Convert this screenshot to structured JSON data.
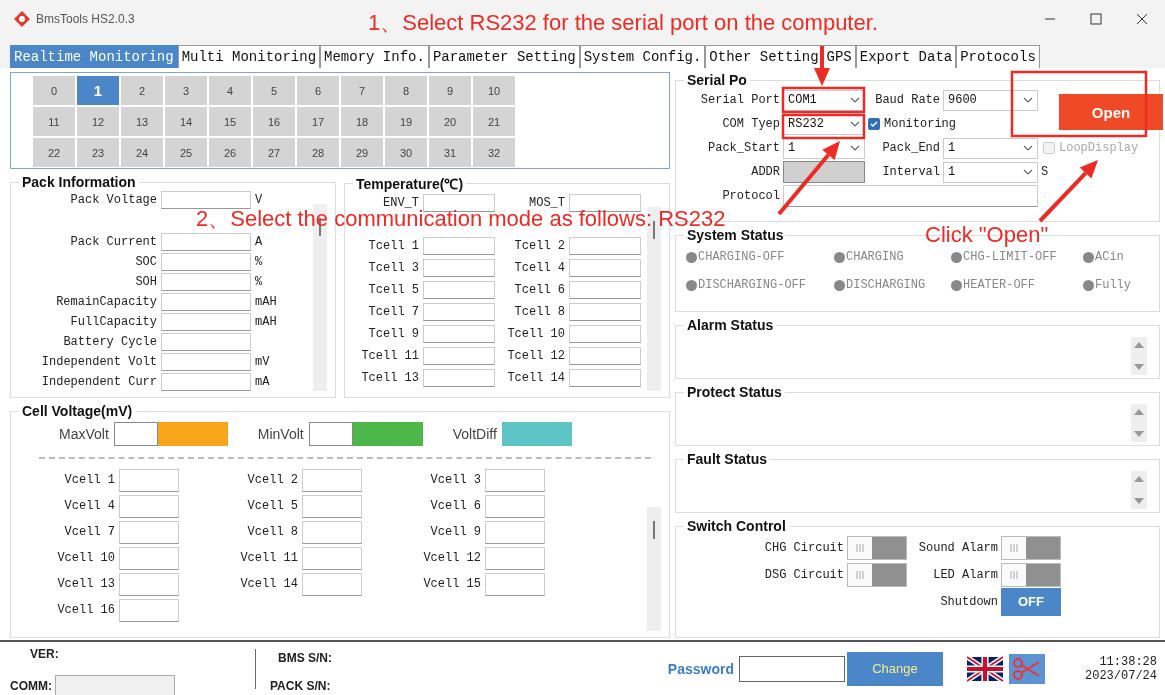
{
  "window": {
    "title": "BmsTools HS2.0.3"
  },
  "tabs": [
    {
      "label": "Realtime Monitoring",
      "selected": true
    },
    {
      "label": "Multi Monitoring",
      "selected": false
    },
    {
      "label": "Memory Info.",
      "selected": false
    },
    {
      "label": "Parameter Setting",
      "selected": false
    },
    {
      "label": "System Config.",
      "selected": false
    },
    {
      "label": "Other Setting",
      "selected": false
    },
    {
      "label": "GPS",
      "selected": false
    },
    {
      "label": "Export Data",
      "selected": false
    },
    {
      "label": "Protocols",
      "selected": false
    }
  ],
  "devices": [
    {
      "label": "0",
      "selected": false
    },
    {
      "label": "1",
      "selected": true
    },
    {
      "label": "2",
      "selected": false
    },
    {
      "label": "3",
      "selected": false
    },
    {
      "label": "4",
      "selected": false
    },
    {
      "label": "5",
      "selected": false
    },
    {
      "label": "6",
      "selected": false
    },
    {
      "label": "7",
      "selected": false
    },
    {
      "label": "8",
      "selected": false
    },
    {
      "label": "9",
      "selected": false
    },
    {
      "label": "10",
      "selected": false
    },
    {
      "label": "11",
      "selected": false
    },
    {
      "label": "12",
      "selected": false
    },
    {
      "label": "13",
      "selected": false
    },
    {
      "label": "14",
      "selected": false
    },
    {
      "label": "15",
      "selected": false
    },
    {
      "label": "16",
      "selected": false
    },
    {
      "label": "17",
      "selected": false
    },
    {
      "label": "18",
      "selected": false
    },
    {
      "label": "19",
      "selected": false
    },
    {
      "label": "20",
      "selected": false
    },
    {
      "label": "21",
      "selected": false
    },
    {
      "label": "22",
      "selected": false
    },
    {
      "label": "23",
      "selected": false
    },
    {
      "label": "24",
      "selected": false
    },
    {
      "label": "25",
      "selected": false
    },
    {
      "label": "26",
      "selected": false
    },
    {
      "label": "27",
      "selected": false
    },
    {
      "label": "28",
      "selected": false
    },
    {
      "label": "29",
      "selected": false
    },
    {
      "label": "30",
      "selected": false
    },
    {
      "label": "31",
      "selected": false
    },
    {
      "label": "32",
      "selected": false
    }
  ],
  "pack_information": {
    "title": "Pack Information",
    "rows": [
      {
        "label": "Pack Voltage",
        "unit": "V"
      },
      {
        "label": "Pack Current",
        "unit": "A"
      },
      {
        "label": "SOC",
        "unit": "%"
      },
      {
        "label": "SOH",
        "unit": "%"
      },
      {
        "label": "RemainCapacity",
        "unit": "mAH"
      },
      {
        "label": "FullCapacity",
        "unit": "mAH"
      },
      {
        "label": "Battery Cycle"
      },
      {
        "label": "Independent Volt",
        "unit": "mV"
      },
      {
        "label": "Independent Curr",
        "unit": "mA"
      }
    ]
  },
  "temperature": {
    "title": "Temperature(℃)",
    "rows": [
      "ENV_T",
      "MOS_T",
      "Tcell 1",
      "Tcell 2",
      "Tcell 3",
      "Tcell 4",
      "Tcell 5",
      "Tcell 6",
      "Tcell 7",
      "Tcell 8",
      "Tcell 9",
      "Tcell 10",
      "Tcell 11",
      "Tcell 12",
      "Tcell 13",
      "Tcell 14"
    ]
  },
  "cell_voltage": {
    "title": "Cell Voltage(mV)",
    "summary": [
      {
        "label": "MaxVolt",
        "kind": "value",
        "color": "#f8a51e"
      },
      {
        "label": "MinVolt",
        "kind": "value",
        "color": "#4cb84a"
      },
      {
        "label": "VoltDiff",
        "kind": "bar",
        "color": "#5cc4c4"
      }
    ],
    "cells": [
      "Vcell 1",
      "Vcell 2",
      "Vcell 3",
      "Vcell 4",
      "Vcell 5",
      "Vcell 6",
      "Vcell 7",
      "Vcell 8",
      "Vcell 9",
      "Vcell 10",
      "Vcell 11",
      "Vcell 12",
      "Vcell 13",
      "Vcell 14",
      "Vcell 15",
      "Vcell 16"
    ]
  },
  "serial_port": {
    "title": "Serial Po",
    "port": {
      "label": "Serial Port",
      "value": "COM1"
    },
    "baud_rate": {
      "label": "Baud Rate",
      "value": "9600"
    },
    "com_type": {
      "label": "COM Tyep",
      "value": "RS232"
    },
    "monitoring": {
      "label": "Monitoring",
      "checked": true
    },
    "pack_start": {
      "label": "Pack_Start",
      "value": "1"
    },
    "pack_end": {
      "label": "Pack_End",
      "value": "1"
    },
    "loop_display": {
      "label": "LoopDisplay",
      "checked": false,
      "disabled": true
    },
    "addr": {
      "label": "ADDR"
    },
    "interval": {
      "label": "Interval",
      "value": "1",
      "unit": "S"
    },
    "protocol": {
      "label": "Protocol"
    },
    "open_button": "Open"
  },
  "system_status": {
    "title": "System Status",
    "indicators": [
      {
        "label": "CHARGING-OFF",
        "on": false
      },
      {
        "label": "CHARGING",
        "on": false
      },
      {
        "label": "CHG-LIMIT-OFF",
        "on": false
      },
      {
        "label": "ACin",
        "on": false
      },
      {
        "label": "DISCHARGING-OFF",
        "on": false
      },
      {
        "label": "DISCHARGING",
        "on": false
      },
      {
        "label": "HEATER-OFF",
        "on": false
      },
      {
        "label": "Fully",
        "on": false
      }
    ]
  },
  "alarm_status": {
    "title": "Alarm Status"
  },
  "protect_status": {
    "title": "Protect Status"
  },
  "fault_status": {
    "title": "Fault Status"
  },
  "switch_control": {
    "title": "Switch Control",
    "switches": [
      {
        "label": "CHG Circuit",
        "on": false
      },
      {
        "label": "Sound Alarm",
        "on": false
      },
      {
        "label": "DSG Circuit",
        "on": false
      },
      {
        "label": "LED Alarm",
        "on": false
      }
    ],
    "shutdown": {
      "label": "Shutdown",
      "button": "OFF"
    }
  },
  "status_bar": {
    "ver_label": "VER:",
    "comm_label": "COMM:",
    "bms_sn_label": "BMS S/N:",
    "pack_sn_label": "PACK S/N:",
    "password_label": "Password",
    "change_button": "Change",
    "time": "11:38:28",
    "date": "2023/07/24"
  },
  "annotations": [
    {
      "text": "1、Select RS232 for the serial port on the computer."
    },
    {
      "text": "2、Select the communication mode as follows: RS232"
    },
    {
      "text": "Click \"Open\""
    }
  ]
}
